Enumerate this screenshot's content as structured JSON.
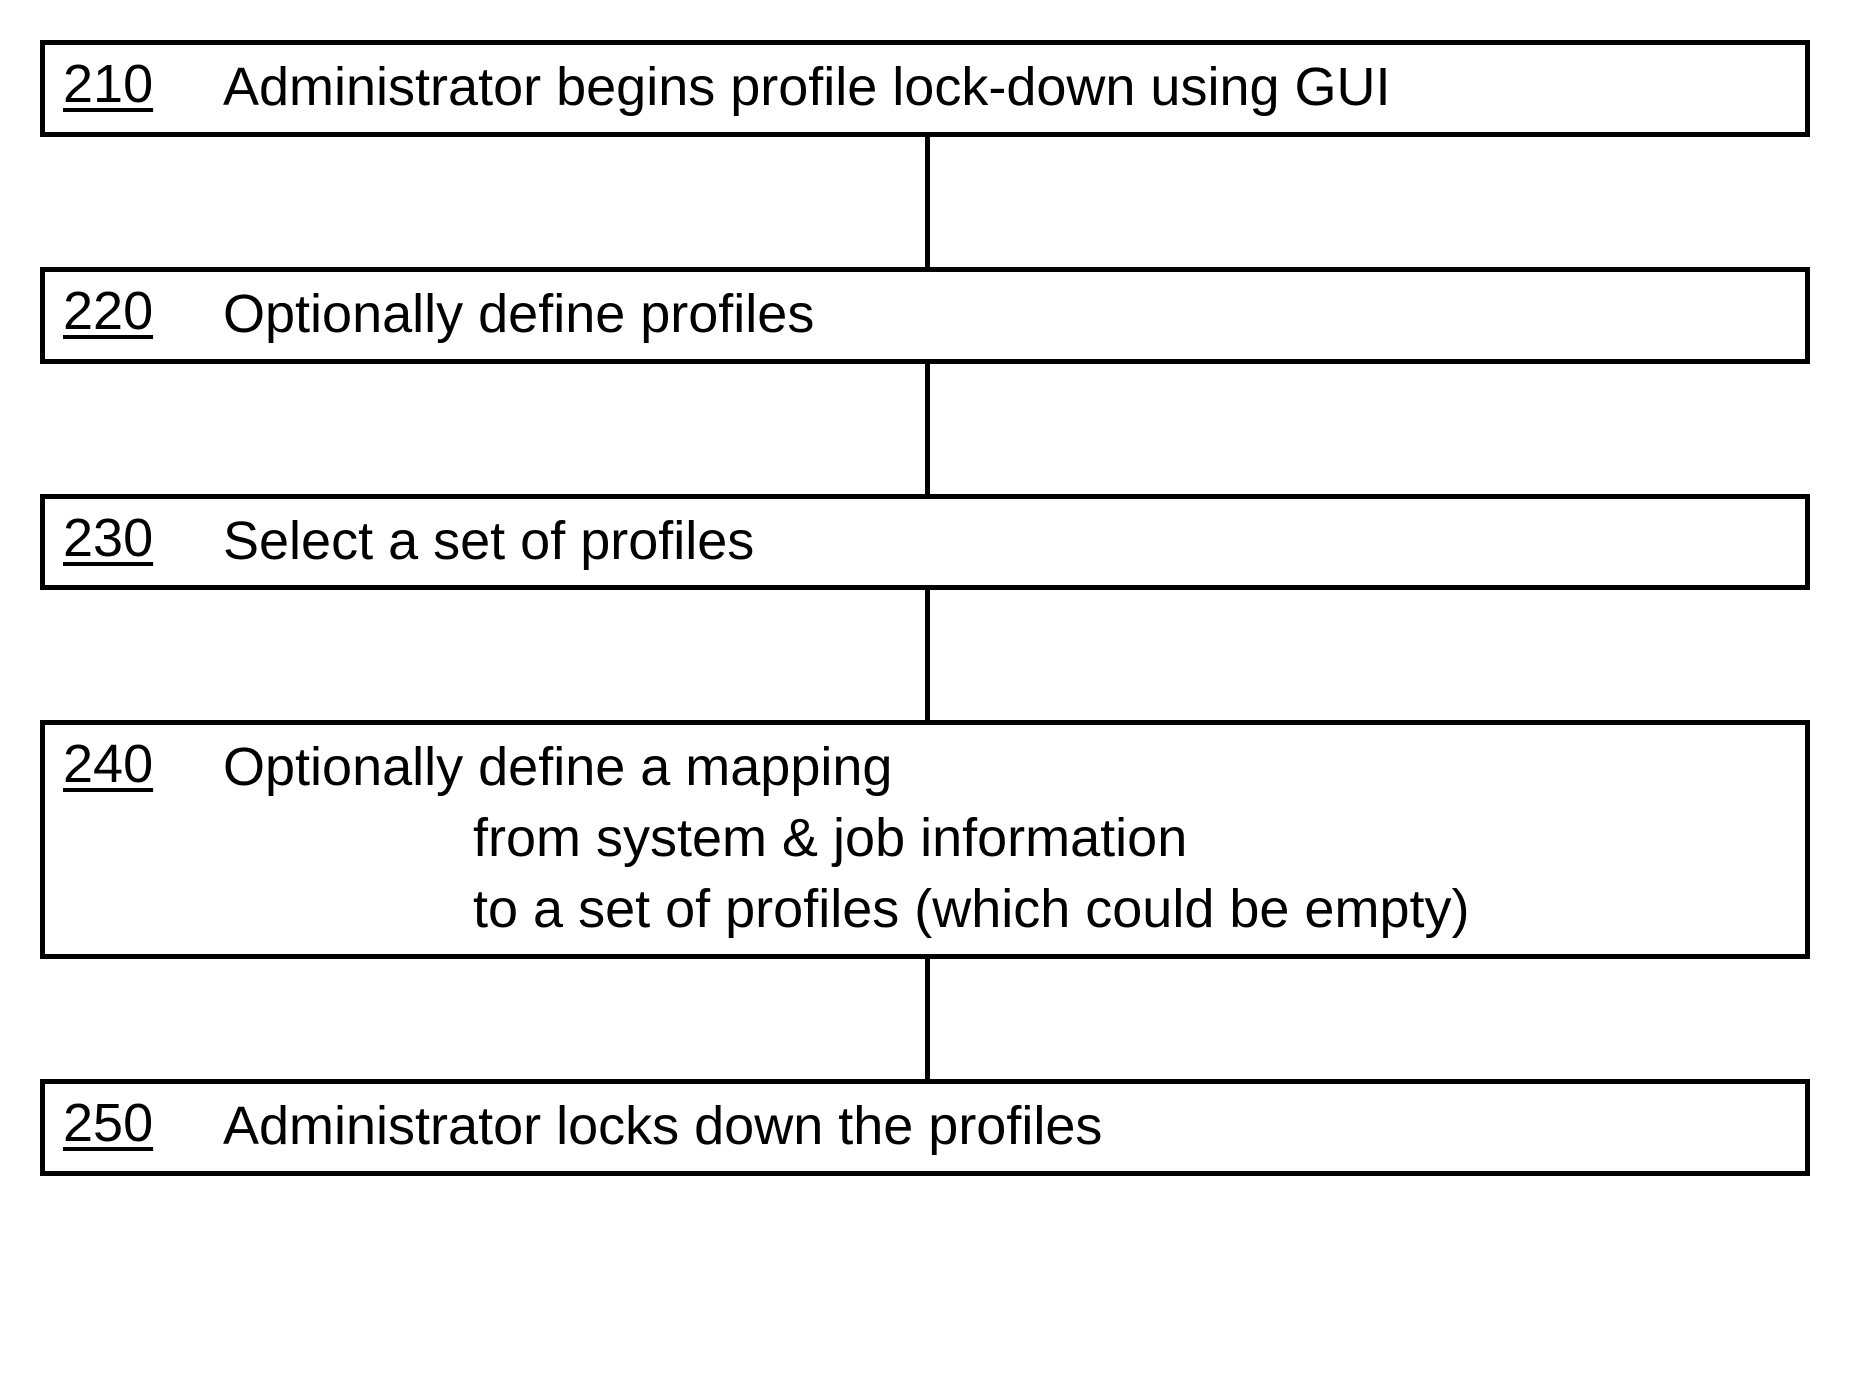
{
  "steps": [
    {
      "num": "210",
      "text": "Administrator begins profile lock-down using GUI"
    },
    {
      "num": "220",
      "text": "Optionally define profiles"
    },
    {
      "num": "230",
      "text": "Select a set of profiles"
    },
    {
      "num": "240",
      "text": "Optionally define a mapping",
      "sub1": "from system & job information",
      "sub2": "to a set of profiles (which could be empty)"
    },
    {
      "num": "250",
      "text": "Administrator locks down the profiles"
    }
  ]
}
